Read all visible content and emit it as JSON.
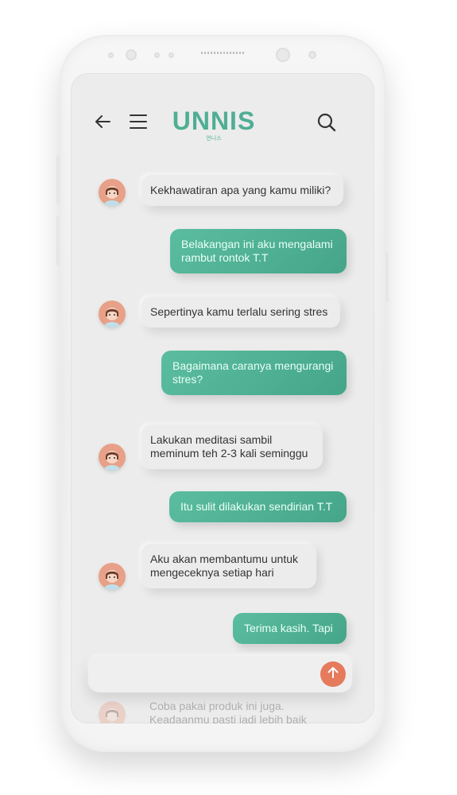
{
  "header": {
    "logo_text": "UNNIS",
    "logo_sub": "언니스",
    "back_icon": "arrow-left-icon",
    "menu_icon": "hamburger-menu-icon",
    "search_icon": "search-icon"
  },
  "chat": {
    "messages": [
      {
        "from": "bot",
        "text": "Kekhawatiran apa yang kamu miliki?"
      },
      {
        "from": "user",
        "text": "Belakangan ini aku mengalami rambut rontok T.T"
      },
      {
        "from": "bot",
        "text": "Sepertinya kamu terlalu sering stres"
      },
      {
        "from": "user",
        "text": "Bagaimana caranya mengurangi stres?"
      },
      {
        "from": "bot",
        "text": "Lakukan meditasi sambil meminum teh 2-3 kali seminggu"
      },
      {
        "from": "user",
        "text": "Itu sulit dilakukan sendirian T.T"
      },
      {
        "from": "bot",
        "text": "Aku akan membantumu untuk mengeceknya setiap hari"
      },
      {
        "from": "user",
        "text": "Terima kasih. Tapi"
      },
      {
        "from": "bot",
        "text": "Coba pakai produk ini juga. Keadaanmu pasti jadi lebih baik"
      }
    ]
  },
  "input": {
    "send_icon": "arrow-up-icon"
  },
  "colors": {
    "accent": "#4fae94",
    "user_bubble": "#52b394",
    "send_button": "#e57a5d",
    "screen_bg": "#ececec"
  }
}
